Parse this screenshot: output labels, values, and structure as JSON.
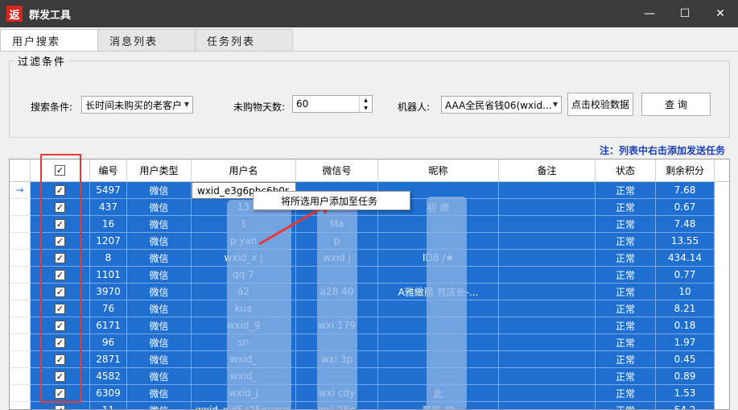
{
  "window": {
    "title": "群发工具",
    "icon_text": "返"
  },
  "window_buttons": {
    "minimize": "—",
    "maximize": "☐",
    "close": "✕"
  },
  "tabs": [
    {
      "label": "用户搜索"
    },
    {
      "label": "消息列表"
    },
    {
      "label": "任务列表"
    }
  ],
  "filter": {
    "group_title": "过滤条件",
    "search_label": "搜索条件:",
    "search_value": "长时间未购买的老客户",
    "days_label": "未购物天数:",
    "days_value": "60",
    "robot_label": "机器人:",
    "robot_value": "AAA全民省钱06(wxid...",
    "verify_button": "点击校验数据",
    "query_button": "查 询"
  },
  "note": "注：列表中右击添加发送任务",
  "table": {
    "headers": [
      "编号",
      "用户类型",
      "用户名",
      "微信号",
      "昵称",
      "备注",
      "状态",
      "剩余积分"
    ],
    "rows": [
      {
        "id": "5497",
        "type": "微信",
        "user": "wxid_e3g6pbc6b0r",
        "wx": "",
        "nick": "",
        "note": "",
        "status": "正常",
        "pts": "7.68"
      },
      {
        "id": "437",
        "type": "微信",
        "user": "13",
        "wx": "",
        "nick": "初 雨",
        "note": "",
        "status": "正常",
        "pts": "0.67"
      },
      {
        "id": "16",
        "type": "微信",
        "user": "1",
        "wx": "Ma",
        "nick": "",
        "note": "",
        "status": "正常",
        "pts": "7.48"
      },
      {
        "id": "1207",
        "type": "微信",
        "user": "p yan",
        "wx": "p",
        "nick": "",
        "note": "",
        "status": "正常",
        "pts": "13.55"
      },
      {
        "id": "8",
        "type": "微信",
        "user": "wxid_x j",
        "wx": "wxid j",
        "nick": "ID8 /★",
        "note": "",
        "status": "正常",
        "pts": "434.14"
      },
      {
        "id": "1101",
        "type": "微信",
        "user": "qq 7",
        "wx": "",
        "nick": "",
        "note": "",
        "status": "正常",
        "pts": "0.77"
      },
      {
        "id": "3970",
        "type": "微信",
        "user": "a2",
        "wx": "a28 40",
        "nick": "A雅緻丽 官店长-...",
        "note": "",
        "status": "正常",
        "pts": "10"
      },
      {
        "id": "76",
        "type": "微信",
        "user": "kua",
        "wx": "",
        "nick": "",
        "note": "",
        "status": "正常",
        "pts": "8.21"
      },
      {
        "id": "6171",
        "type": "微信",
        "user": "wxid_9",
        "wx": "wxi 179",
        "nick": "",
        "note": "",
        "status": "正常",
        "pts": "0.18"
      },
      {
        "id": "96",
        "type": "微信",
        "user": "sn",
        "wx": "",
        "nick": "",
        "note": "",
        "status": "正常",
        "pts": "1.97"
      },
      {
        "id": "2871",
        "type": "微信",
        "user": "wxid_",
        "wx": "wxi 3p",
        "nick": "",
        "note": "",
        "status": "正常",
        "pts": "0.45"
      },
      {
        "id": "4582",
        "type": "微信",
        "user": "wxid_",
        "wx": "",
        "nick": "",
        "note": "",
        "status": "正常",
        "pts": "0.89"
      },
      {
        "id": "6309",
        "type": "微信",
        "user": "wxid_j",
        "wx": "wxi cdy",
        "nick": "此 ",
        "note": "",
        "status": "正常",
        "pts": "1.53"
      },
      {
        "id": "11",
        "type": "微信",
        "user": "wxid_xid5c25puevp",
        "wx": "wxi 25p",
        "nick": "薇薇 福",
        "note": "",
        "status": "正常",
        "pts": "54.2"
      }
    ]
  },
  "context_menu": {
    "item": "将所选用户添加至任务"
  },
  "icons": {
    "row_pointer": "arrow-right-icon",
    "check": "check-icon"
  },
  "colors": {
    "selection": "#1f6fd1",
    "highlight": "#e53935",
    "note": "#1a3fb8",
    "titlebar": "#3b3b3b"
  }
}
